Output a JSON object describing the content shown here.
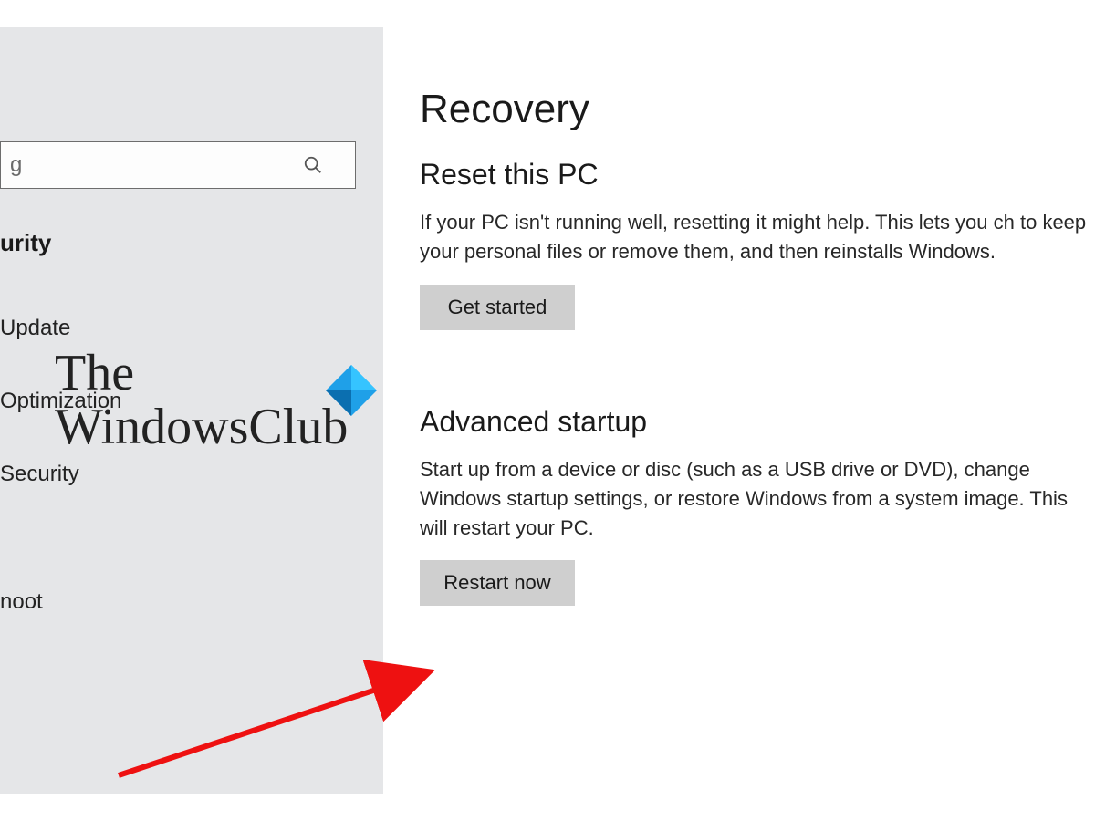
{
  "sidebar": {
    "search_placeholder": "g",
    "category_header": "urity",
    "items": [
      {
        "label": "Update"
      },
      {
        "label": "Optimization"
      },
      {
        "label": "Security"
      },
      {
        "label": "noot"
      }
    ]
  },
  "page": {
    "title": "Recovery",
    "reset": {
      "heading": "Reset this PC",
      "body": "If your PC isn't running well, resetting it might help. This lets you ch to keep your personal files or remove them, and then reinstalls Windows.",
      "button": "Get started"
    },
    "advanced": {
      "heading": "Advanced startup",
      "body": "Start up from a device or disc (such as a USB drive or DVD), change Windows startup settings, or restore Windows from a system image. This will restart your PC.",
      "button": "Restart now"
    }
  },
  "watermark": {
    "line1": "The",
    "line2": "WindowsClub"
  }
}
